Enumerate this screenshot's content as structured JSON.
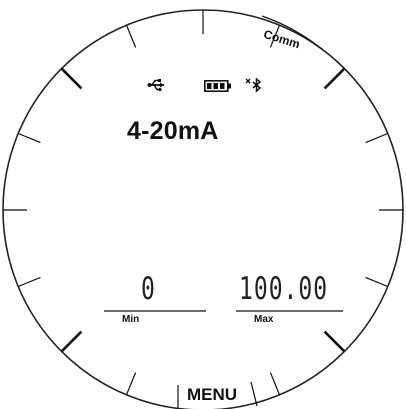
{
  "display": {
    "mode": "4-20mA",
    "comm_label": "Comm",
    "menu_label": "MENU",
    "min": {
      "label": "Min",
      "value": "0"
    },
    "max": {
      "label": "Max",
      "value": "100.00"
    }
  },
  "status_icons": [
    "usb-icon",
    "battery-icon",
    "bluetooth-off-icon"
  ],
  "colors": {
    "background": "#ffffff",
    "ink": "#111111"
  }
}
